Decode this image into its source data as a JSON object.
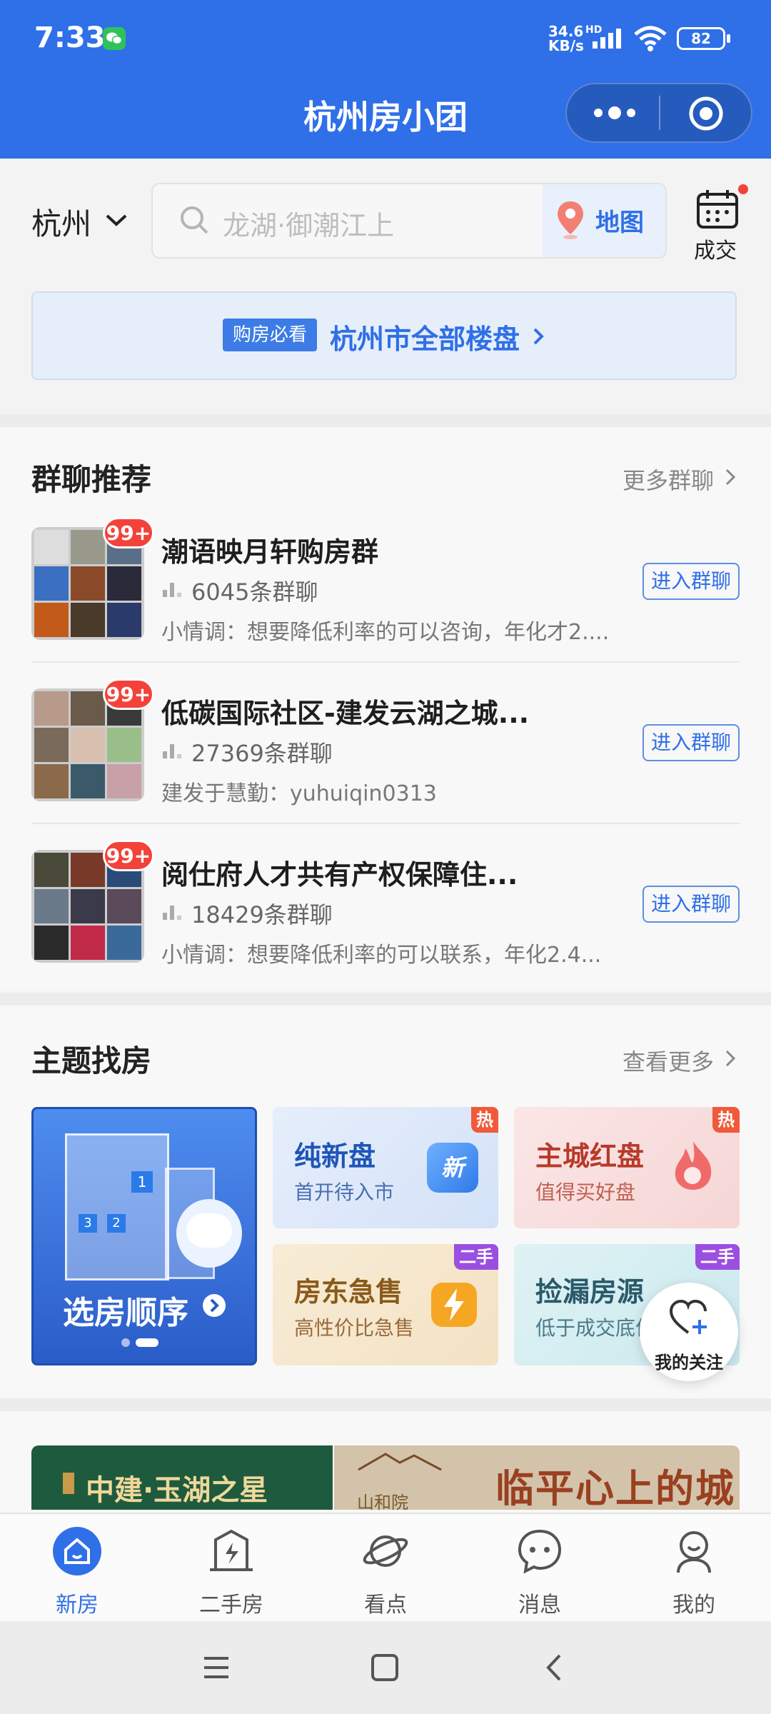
{
  "status_bar": {
    "time": "7:33",
    "net_speed_value": "34.6",
    "net_speed_unit": "KB/s",
    "hd": "HD",
    "battery": "82"
  },
  "header": {
    "title": "杭州房小团"
  },
  "search": {
    "city": "杭州",
    "placeholder": "龙湖·御潮江上",
    "map_label": "地图",
    "deal_label": "成交"
  },
  "banner": {
    "tag": "购房必看",
    "text": "杭州市全部楼盘"
  },
  "groups": {
    "title": "群聊推荐",
    "more": "更多群聊",
    "items": [
      {
        "badge": "99+",
        "name": "潮语映月轩购房群",
        "count": "6045条群聊",
        "message": "小情调：想要降低利率的可以咨询，年化才2....",
        "button": "进入群聊"
      },
      {
        "badge": "99+",
        "name": "低碳国际社区-建发云湖之城...",
        "count": "27369条群聊",
        "message": "建发于慧勤：yuhuiqin0313",
        "button": "进入群聊"
      },
      {
        "badge": "99+",
        "name": "阅仕府人才共有产权保障住...",
        "count": "18429条群聊",
        "message": "小情调：想要降低利率的可以联系，年化2.4...",
        "button": "进入群聊"
      }
    ]
  },
  "theme": {
    "title": "主题找房",
    "more": "查看更多",
    "big_tile": {
      "label": "选房顺序",
      "numbers": [
        "1",
        "3",
        "2"
      ]
    },
    "tiles": [
      {
        "title": "纯新盘",
        "sub": "首开待入市",
        "corner": "热",
        "icon_text": "新"
      },
      {
        "title": "主城红盘",
        "sub": "值得买好盘",
        "corner": "热"
      },
      {
        "title": "房东急售",
        "sub": "高性价比急售",
        "corner": "二手"
      },
      {
        "title": "捡漏房源",
        "sub": "低于成交底价",
        "corner": "二手"
      }
    ],
    "colors": {
      "blue": "#2f6fe8",
      "red": "#f3423a",
      "purple": "#9b4fe0"
    }
  },
  "follow": {
    "label": "我的关注"
  },
  "ads": {
    "left": "中建·玉湖之星",
    "right": "临平心上的城",
    "right_logo": "山和院"
  },
  "nav": {
    "items": [
      {
        "label": "新房",
        "icon": "home-icon",
        "active": true
      },
      {
        "label": "二手房",
        "icon": "second-hand-house-icon",
        "active": false
      },
      {
        "label": "看点",
        "icon": "planet-icon",
        "active": false
      },
      {
        "label": "消息",
        "icon": "chat-icon",
        "active": false
      },
      {
        "label": "我的",
        "icon": "person-icon",
        "active": false
      }
    ]
  }
}
